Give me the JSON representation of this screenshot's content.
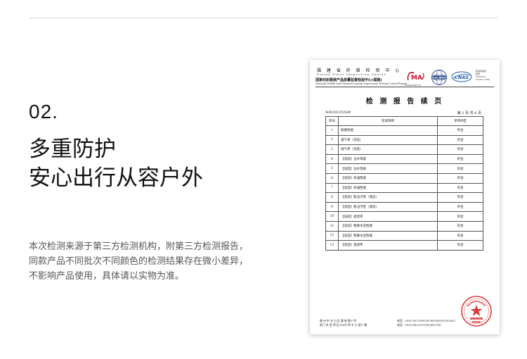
{
  "section": {
    "number": "02.",
    "title_line1": "多重防护",
    "title_line2": "安心出行从容户外",
    "desc_lines": [
      "本次检测来源于第三方检测机构，附第三方检测报告，",
      "同款产品不同批次不同颜色的检测结果存在微小差异，",
      "不影响产品使用，具体请以实物为准。"
    ]
  },
  "report": {
    "org_cn": "福 建 省 纤 维 检 验 中 心",
    "org_en": "Fujian Fiber Inspection Center",
    "center_cn": "国家纺织服装产品质量监督检验中心(福建)",
    "center_en": "National Textile And Garment Quality Supervision Testing Center(Fujian)",
    "ma_number": "220000340178",
    "side_text": [
      "检测实验室",
      "检测",
      "TESTING",
      "CNAS L1998"
    ],
    "title": "检 测 报 告 续 页",
    "report_no": "№W2013558#",
    "page_info": "第 2 页 共 6 页",
    "columns": [
      "序号",
      "检测项目",
      "单项判定"
    ],
    "rows": [
      {
        "no": "1",
        "item": "耐磨性能",
        "result": "符合"
      },
      {
        "no": "2",
        "item": "透气率（洗前）",
        "result": "符合"
      },
      {
        "no": "3",
        "item": "透气率（洗后）",
        "result": "符合"
      },
      {
        "no": "4",
        "item": "【洗前】沾水等级",
        "result": "符合"
      },
      {
        "no": "5",
        "item": "【洗后】沾水等级",
        "result": "符合"
      },
      {
        "no": "6",
        "item": "【洗前】抗油性能",
        "result": "符合"
      },
      {
        "no": "7",
        "item": "【洗后】抗油性能",
        "result": "符合"
      },
      {
        "no": "8",
        "item": "【洗前】耐沾污性（液态）",
        "result": "符合"
      },
      {
        "no": "9",
        "item": "【洗后】耐沾污性（液态）",
        "result": "符合"
      },
      {
        "no": "10",
        "item": "【洗前】透湿率",
        "result": "符合"
      },
      {
        "no": "11",
        "item": "【洗前】耐静水压性能",
        "result": "符合"
      },
      {
        "no": "12",
        "item": "【洗后】耐静水压性能",
        "result": "符合"
      },
      {
        "no": "13",
        "item": "【洗后】透湿率",
        "result": "符合"
      }
    ],
    "footer_left": [
      "福 州 市 仓 山 区 建 新 路17号",
      "厦门 市 思 明 区236号 明 丰 大 厦17楼"
    ],
    "footer_right": [
      "电话：0591-83710601/87887065/87893952",
      "电话：0595-88123970/82682768"
    ],
    "stamp_text": "检验检测专用章"
  }
}
